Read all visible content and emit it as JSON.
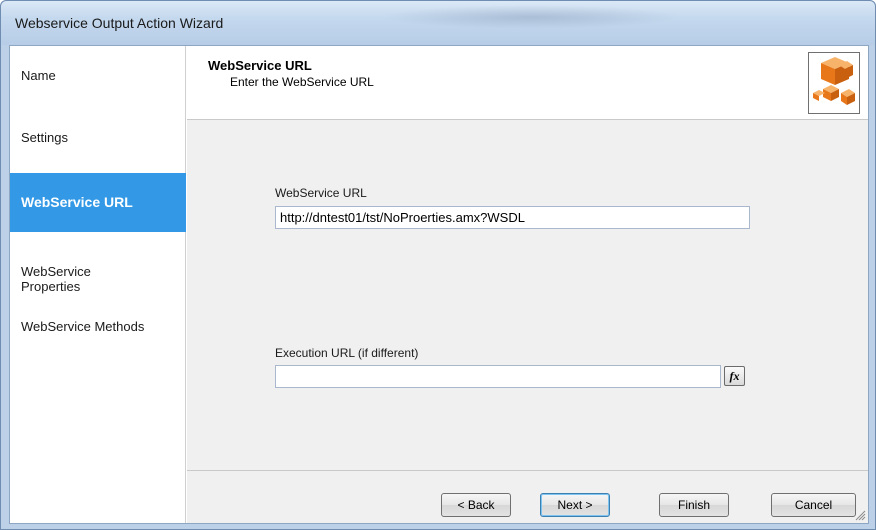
{
  "window": {
    "title": "Webservice Output Action Wizard"
  },
  "sidebar": {
    "items": [
      {
        "label": "Name",
        "active": false
      },
      {
        "label": "Settings",
        "active": false
      },
      {
        "label": "WebService URL",
        "active": true
      },
      {
        "label": "WebService\nProperties",
        "active": false
      },
      {
        "label": "WebService Methods",
        "active": false
      }
    ]
  },
  "header": {
    "title": "WebService URL",
    "subtitle": "Enter the WebService URL",
    "logo_icon": "orange-cubes-icon"
  },
  "form": {
    "webservice_url_label": "WebService URL",
    "webservice_url_value": "http://dntest01/tst/NoProerties.amx?WSDL",
    "execution_url_label": "Execution URL (if different)",
    "execution_url_value": "",
    "fx_label": "fx"
  },
  "footer": {
    "back_label": "< Back",
    "next_label": "Next >",
    "finish_label": "Finish",
    "cancel_label": "Cancel"
  },
  "colors": {
    "active_nav": "#3399e6",
    "logo_orange": "#f08a24"
  }
}
